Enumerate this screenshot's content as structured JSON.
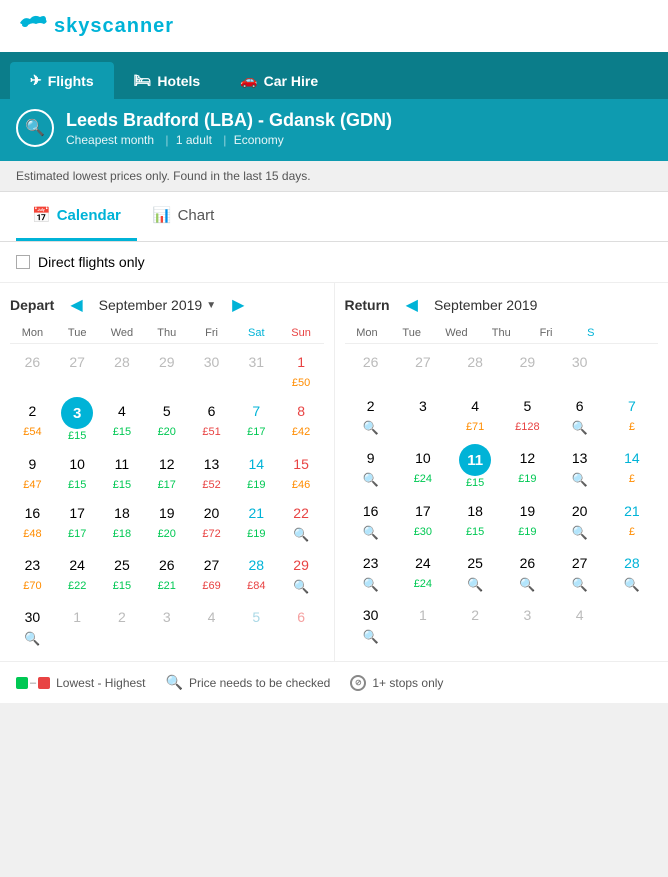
{
  "logo": {
    "text": "skyscanner"
  },
  "tabs": [
    {
      "label": "Flights",
      "icon": "✈",
      "active": true
    },
    {
      "label": "Hotels",
      "icon": "🛏",
      "active": false
    },
    {
      "label": "Car Hire",
      "icon": "🚗",
      "active": false
    }
  ],
  "search": {
    "route": "Leeds Bradford (LBA) - Gdansk (GDN)",
    "cheapest_month": "Cheapest month",
    "adults": "1 adult",
    "class": "Economy"
  },
  "notice": "Estimated lowest prices only. Found in the last 15 days.",
  "view_tabs": [
    {
      "label": "Calendar",
      "icon": "📅",
      "active": true
    },
    {
      "label": "Chart",
      "icon": "📊",
      "active": false
    }
  ],
  "direct_flights_label": "Direct flights only",
  "depart": {
    "label": "Depart",
    "month": "September 2019",
    "days": [
      "Mon",
      "Tue",
      "Wed",
      "Thu",
      "Fri",
      "Sat",
      "Sun"
    ],
    "rows": [
      [
        {
          "num": 26,
          "price": "",
          "empty": true
        },
        {
          "num": 27,
          "price": "",
          "empty": true
        },
        {
          "num": 28,
          "price": "",
          "empty": true
        },
        {
          "num": 29,
          "price": "",
          "empty": true
        },
        {
          "num": 30,
          "price": "",
          "empty": true
        },
        {
          "num": 31,
          "price": "",
          "empty": true
        },
        {
          "num": 1,
          "price": "£50",
          "priceColor": "orange",
          "col": "sun",
          "empty": false
        }
      ],
      [
        {
          "num": 2,
          "price": "£54",
          "priceColor": "orange",
          "empty": false
        },
        {
          "num": 3,
          "price": "£15",
          "priceColor": "green",
          "empty": false,
          "selected": true
        },
        {
          "num": 4,
          "price": "£15",
          "priceColor": "green",
          "empty": false
        },
        {
          "num": 5,
          "price": "£20",
          "priceColor": "green",
          "empty": false
        },
        {
          "num": 6,
          "price": "£51",
          "priceColor": "red",
          "empty": false
        },
        {
          "num": 7,
          "price": "£17",
          "priceColor": "green",
          "empty": false,
          "col": "sat"
        },
        {
          "num": 8,
          "price": "£42",
          "priceColor": "orange",
          "empty": false,
          "col": "sun"
        }
      ],
      [
        {
          "num": 9,
          "price": "£47",
          "priceColor": "orange",
          "empty": false
        },
        {
          "num": 10,
          "price": "£15",
          "priceColor": "green",
          "empty": false
        },
        {
          "num": 11,
          "price": "£15",
          "priceColor": "green",
          "empty": false
        },
        {
          "num": 12,
          "price": "£17",
          "priceColor": "green",
          "empty": false
        },
        {
          "num": 13,
          "price": "£52",
          "priceColor": "red",
          "empty": false
        },
        {
          "num": 14,
          "price": "£19",
          "priceColor": "green",
          "empty": false,
          "col": "sat"
        },
        {
          "num": 15,
          "price": "£46",
          "priceColor": "orange",
          "empty": false,
          "col": "sun"
        }
      ],
      [
        {
          "num": 16,
          "price": "£48",
          "priceColor": "orange",
          "empty": false
        },
        {
          "num": 17,
          "price": "£17",
          "priceColor": "green",
          "empty": false
        },
        {
          "num": 18,
          "price": "£18",
          "priceColor": "green",
          "empty": false
        },
        {
          "num": 19,
          "price": "£20",
          "priceColor": "green",
          "empty": false
        },
        {
          "num": 20,
          "price": "£72",
          "priceColor": "red",
          "empty": false
        },
        {
          "num": 21,
          "price": "£19",
          "priceColor": "green",
          "empty": false,
          "col": "sat"
        },
        {
          "num": 22,
          "price": "🔍",
          "priceColor": "search",
          "empty": false,
          "col": "sun"
        }
      ],
      [
        {
          "num": 23,
          "price": "£70",
          "priceColor": "orange",
          "empty": false
        },
        {
          "num": 24,
          "price": "£22",
          "priceColor": "green",
          "empty": false
        },
        {
          "num": 25,
          "price": "£15",
          "priceColor": "green",
          "empty": false
        },
        {
          "num": 26,
          "price": "£21",
          "priceColor": "green",
          "empty": false
        },
        {
          "num": 27,
          "price": "£69",
          "priceColor": "red",
          "empty": false
        },
        {
          "num": 28,
          "price": "£84",
          "priceColor": "red",
          "empty": false,
          "col": "sat"
        },
        {
          "num": 29,
          "price": "🔍",
          "priceColor": "search",
          "empty": false,
          "col": "sun"
        }
      ],
      [
        {
          "num": 30,
          "price": "🔍",
          "priceColor": "search",
          "empty": false
        },
        {
          "num": 1,
          "price": "",
          "empty": true
        },
        {
          "num": 2,
          "price": "",
          "empty": true
        },
        {
          "num": 3,
          "price": "",
          "empty": true
        },
        {
          "num": 4,
          "price": "",
          "empty": true
        },
        {
          "num": 5,
          "price": "",
          "empty": true,
          "col": "sat"
        },
        {
          "num": 6,
          "price": "",
          "empty": true,
          "col": "sun"
        }
      ]
    ]
  },
  "return": {
    "label": "Return",
    "month": "September 2019",
    "days": [
      "Mon",
      "Tue",
      "Wed",
      "Thu",
      "Fri",
      "S"
    ],
    "rows": [
      [
        {
          "num": 26,
          "price": "",
          "empty": true
        },
        {
          "num": 27,
          "price": "",
          "empty": true
        },
        {
          "num": 28,
          "price": "",
          "empty": true
        },
        {
          "num": 29,
          "price": "",
          "empty": true
        },
        {
          "num": 30,
          "price": "",
          "empty": true
        },
        {
          "num": "",
          "price": "",
          "empty": true
        }
      ],
      [
        {
          "num": 2,
          "price": "🔍",
          "priceColor": "search",
          "empty": false
        },
        {
          "num": 3,
          "price": "",
          "priceColor": "",
          "empty": false
        },
        {
          "num": 4,
          "price": "£71",
          "priceColor": "orange",
          "empty": false
        },
        {
          "num": 5,
          "price": "£128",
          "priceColor": "red",
          "empty": false
        },
        {
          "num": 6,
          "price": "🔍",
          "priceColor": "search",
          "empty": false
        },
        {
          "num": 7,
          "price": "£",
          "priceColor": "orange",
          "empty": false,
          "col": "sat"
        }
      ],
      [
        {
          "num": 9,
          "price": "🔍",
          "priceColor": "search",
          "empty": false
        },
        {
          "num": 10,
          "price": "£24",
          "priceColor": "green",
          "empty": false
        },
        {
          "num": 11,
          "price": "£15",
          "priceColor": "green",
          "empty": false,
          "selected": true
        },
        {
          "num": 12,
          "price": "£19",
          "priceColor": "green",
          "empty": false
        },
        {
          "num": 13,
          "price": "🔍",
          "priceColor": "search",
          "empty": false
        },
        {
          "num": 14,
          "price": "£",
          "priceColor": "orange",
          "empty": false,
          "col": "sat"
        }
      ],
      [
        {
          "num": 16,
          "price": "🔍",
          "priceColor": "search",
          "empty": false
        },
        {
          "num": 17,
          "price": "£30",
          "priceColor": "green",
          "empty": false
        },
        {
          "num": 18,
          "price": "£15",
          "priceColor": "green",
          "empty": false
        },
        {
          "num": 19,
          "price": "£19",
          "priceColor": "green",
          "empty": false
        },
        {
          "num": 20,
          "price": "🔍",
          "priceColor": "search",
          "empty": false
        },
        {
          "num": 21,
          "price": "£",
          "priceColor": "orange",
          "empty": false,
          "col": "sat"
        }
      ],
      [
        {
          "num": 23,
          "price": "🔍",
          "priceColor": "search",
          "empty": false
        },
        {
          "num": 24,
          "price": "£24",
          "priceColor": "green",
          "empty": false
        },
        {
          "num": 25,
          "price": "🔍",
          "priceColor": "search",
          "empty": false
        },
        {
          "num": 26,
          "price": "🔍",
          "priceColor": "search",
          "empty": false
        },
        {
          "num": 27,
          "price": "🔍",
          "priceColor": "search",
          "empty": false
        },
        {
          "num": 28,
          "price": "🔍",
          "priceColor": "search",
          "empty": false,
          "col": "sat"
        }
      ],
      [
        {
          "num": 30,
          "price": "🔍",
          "priceColor": "search",
          "empty": false
        },
        {
          "num": 1,
          "price": "",
          "empty": true
        },
        {
          "num": 2,
          "price": "",
          "empty": true
        },
        {
          "num": 3,
          "price": "",
          "empty": true
        },
        {
          "num": 4,
          "price": "",
          "empty": true
        },
        {
          "num": "",
          "price": "",
          "empty": true
        }
      ]
    ]
  },
  "legend": {
    "lowest_highest": "Lowest - Highest",
    "price_check": "Price needs to be checked",
    "stops": "1+ stops only"
  }
}
